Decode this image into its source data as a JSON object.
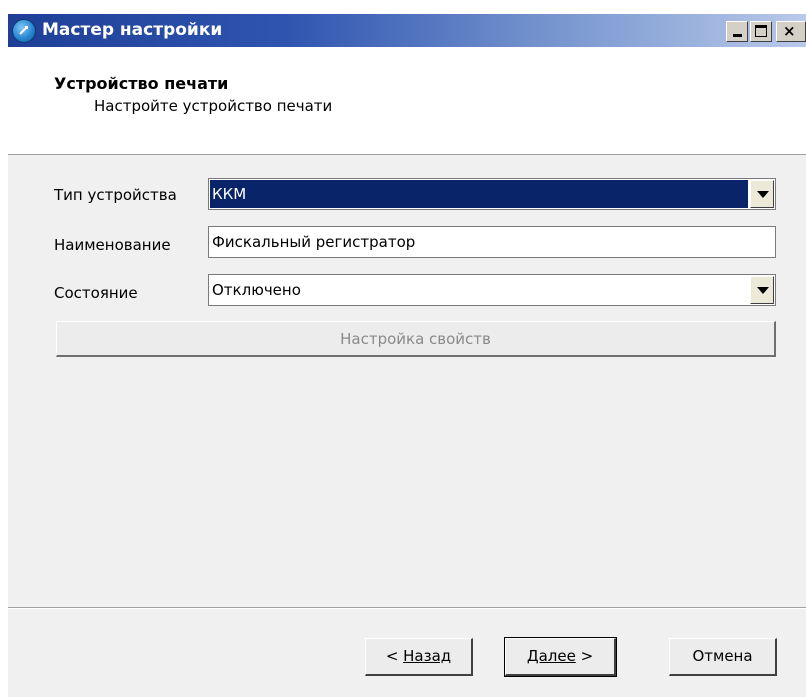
{
  "window": {
    "title": "Мастер настройки"
  },
  "header": {
    "title": "Устройство печати",
    "subtitle": "Настройте устройство печати"
  },
  "form": {
    "device_type_label": "Тип устройства",
    "device_type_value": "ККМ",
    "name_label": "Наименование",
    "name_value": "Фискальный регистратор",
    "state_label": "Состояние",
    "state_value": "Отключено",
    "props_button_label": "Настройка свойств"
  },
  "buttons": {
    "back_prefix": "< ",
    "back_label": "Назад",
    "next_label": "Далее",
    "next_suffix": " >",
    "cancel_label": "Отмена"
  },
  "colors": {
    "selection": "#0a246a",
    "titlebar_start": "#1f3f96",
    "disabled_text": "#8a8a8a"
  },
  "icons": {
    "app": "wizard-app-icon",
    "minimize": "minimize-icon",
    "maximize": "maximize-icon",
    "close": "close-icon",
    "dropdown": "chevron-down-icon"
  }
}
